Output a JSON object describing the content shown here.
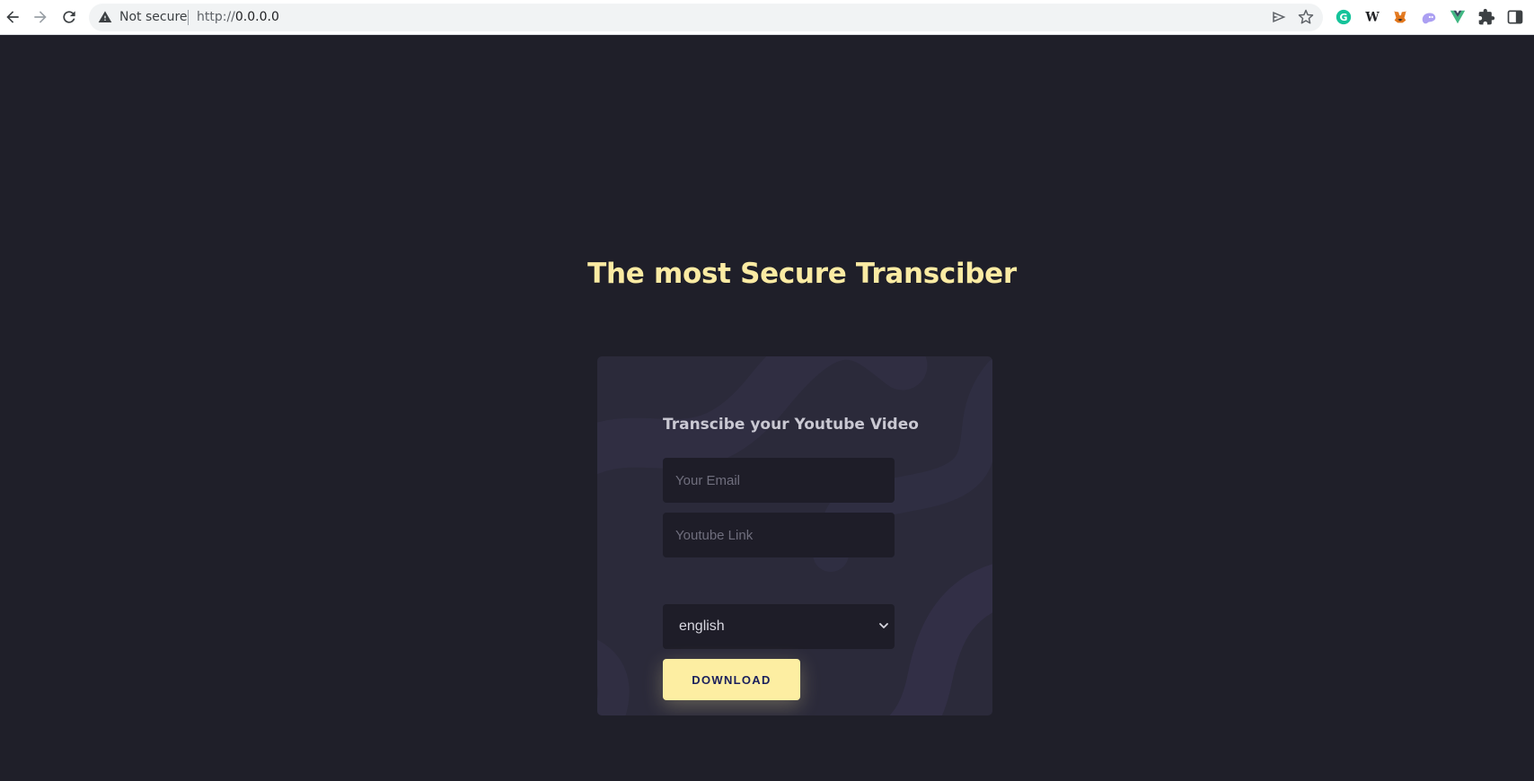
{
  "browser": {
    "security_label": "Not secure",
    "url_scheme": "http://",
    "url_host": "0.0.0.0",
    "extensions": [
      {
        "name": "grammarly",
        "glyph": "G",
        "color": "#15c39a"
      },
      {
        "name": "wikipedia",
        "glyph": "W",
        "color": "#202124"
      },
      {
        "name": "metamask",
        "glyph": "🦊",
        "color": "#e2761b"
      },
      {
        "name": "phantom",
        "glyph": "👻",
        "color": "#ab9ff2"
      },
      {
        "name": "vue-devtools",
        "glyph": "V",
        "color": "#41b883"
      }
    ]
  },
  "hero": {
    "title": "The most Secure Transciber"
  },
  "form": {
    "title": "Transcibe your Youtube Video",
    "email_placeholder": "Your Email",
    "link_placeholder": "Youtube Link",
    "language_selected": "english",
    "download_label": "DOWNLOAD"
  },
  "colors": {
    "background": "#1f1f29",
    "card": "#2b2a3a",
    "accent": "#fdeea2",
    "title": "#fbeba3",
    "button_text": "#1a1f5c"
  }
}
